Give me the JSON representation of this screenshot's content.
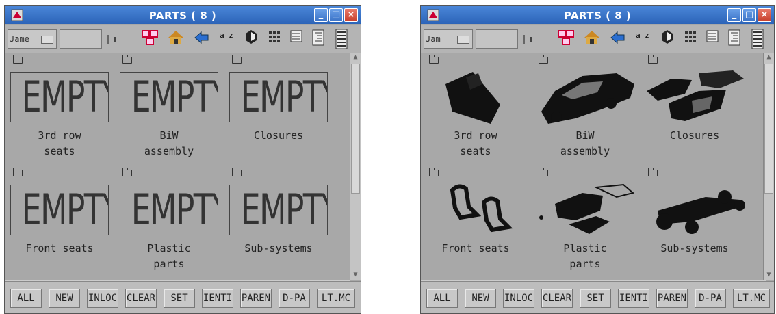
{
  "windows": [
    {
      "title": "PARTS ( 8 )",
      "name_field": "Jame",
      "win_buttons": [
        "_",
        "□",
        "×"
      ],
      "sort_label": "a z",
      "parts": [
        {
          "label": "3rd row\nseats",
          "thumb": "EMPTY"
        },
        {
          "label": "BiW\nassembly",
          "thumb": "EMPTY"
        },
        {
          "label": "Closures",
          "thumb": "EMPTY"
        },
        {
          "label": "Front seats",
          "thumb": "EMPTY"
        },
        {
          "label": "Plastic\nparts",
          "thumb": "EMPTY"
        },
        {
          "label": "Sub-systems",
          "thumb": "EMPTY"
        }
      ],
      "buttons": [
        "ALL",
        "NEW",
        "INLOC",
        "CLEAR",
        "SET",
        "IENTI",
        "PAREN",
        "D-PA",
        "LT.MC"
      ]
    },
    {
      "title": "PARTS ( 8 )",
      "name_field": "Jam",
      "win_buttons": [
        "_",
        "□",
        "×"
      ],
      "sort_label": "a z",
      "parts": [
        {
          "label": "3rd row\nseats",
          "thumb": "seat-shape"
        },
        {
          "label": "BiW\nassembly",
          "thumb": "car-body-shape"
        },
        {
          "label": "Closures",
          "thumb": "closures-shape"
        },
        {
          "label": "Front seats",
          "thumb": "front-seats-shape"
        },
        {
          "label": "Plastic\nparts",
          "thumb": "plastic-parts-shape"
        },
        {
          "label": "Sub-systems",
          "thumb": "chassis-shape"
        }
      ],
      "buttons": [
        "ALL",
        "NEW",
        "INLOC",
        "CLEAR",
        "SET",
        "IENTI",
        "PAREN",
        "D-PA",
        "LT.MC"
      ]
    }
  ]
}
